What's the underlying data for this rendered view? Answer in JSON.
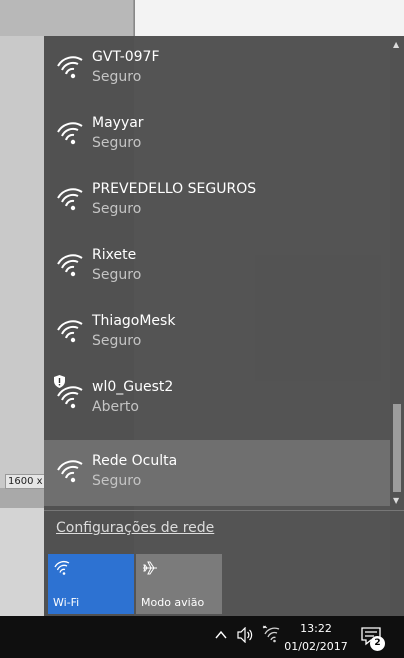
{
  "background": {
    "size_label": "1600 x"
  },
  "networks": [
    {
      "name": "GVT-097F",
      "status": "Seguro",
      "icon": "wifi-icon"
    },
    {
      "name": "Mayyar",
      "status": "Seguro",
      "icon": "wifi-icon"
    },
    {
      "name": "PREVEDELLO SEGUROS",
      "status": "Seguro",
      "icon": "wifi-icon"
    },
    {
      "name": "Rixete",
      "status": "Seguro",
      "icon": "wifi-icon"
    },
    {
      "name": "ThiagoMesk",
      "status": "Seguro",
      "icon": "wifi-icon"
    },
    {
      "name": "wl0_Guest2",
      "status": "Aberto",
      "icon": "wifi-icon",
      "badge": "shield-icon"
    },
    {
      "name": "Rede Oculta",
      "status": "Seguro",
      "icon": "wifi-icon",
      "selected": true
    }
  ],
  "settings_link": "Configurações de rede",
  "quick_actions": [
    {
      "label": "Wi-Fi",
      "icon": "wifi-icon",
      "active": true,
      "color": "#2d72d2"
    },
    {
      "label": "Modo avião",
      "icon": "airplane-icon",
      "active": false,
      "color": "#7b7b7b"
    }
  ],
  "taskbar": {
    "time": "13:22",
    "date": "01/02/2017",
    "notification_count": "2"
  }
}
